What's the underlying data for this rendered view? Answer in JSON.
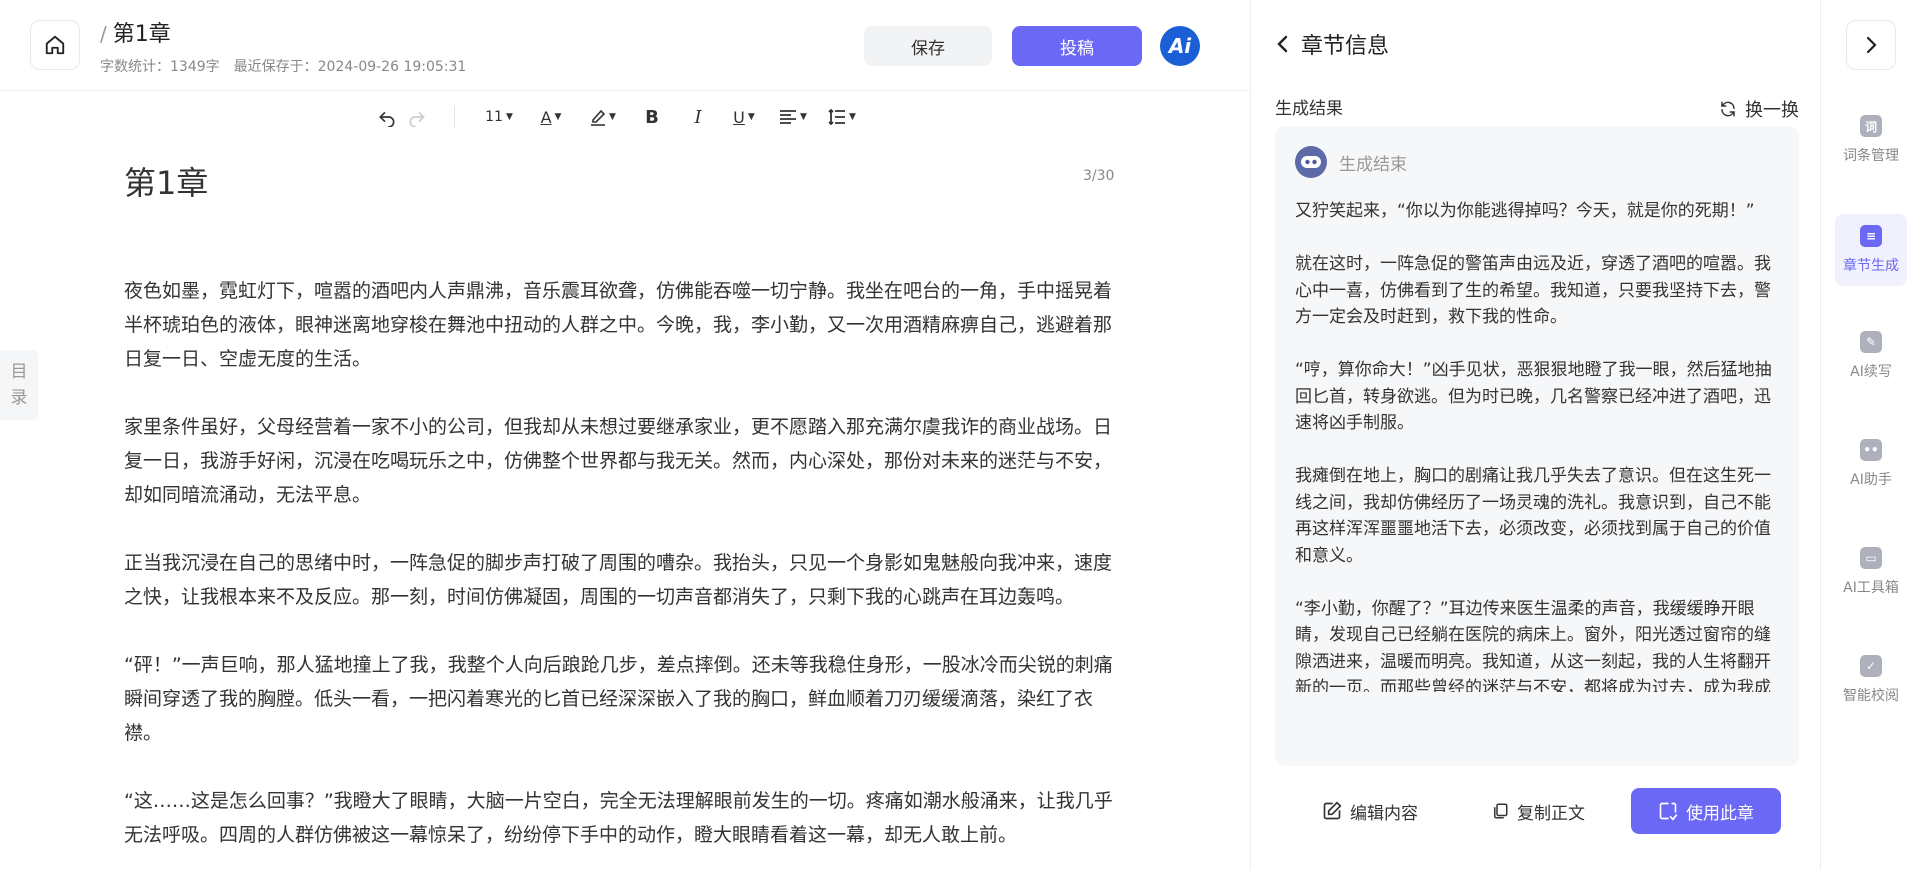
{
  "header": {
    "title": "第1章",
    "word_count": "字数统计：1349字",
    "last_saved": "最近保存于：2024-09-26 19:05:31",
    "save_label": "保存",
    "submit_label": "投稿",
    "ai_badge": "Ai"
  },
  "toolbar": {
    "font_size": "11"
  },
  "editor": {
    "chapter_title": "第1章",
    "counter": "3/30",
    "toc_char1": "目",
    "toc_char2": "录",
    "paragraphs": [
      "夜色如墨，霓虹灯下，喧嚣的酒吧内人声鼎沸，音乐震耳欲聋，仿佛能吞噬一切宁静。我坐在吧台的一角，手中摇晃着半杯琥珀色的液体，眼神迷离地穿梭在舞池中扭动的人群之中。今晚，我，李小勤，又一次用酒精麻痹自己，逃避着那日复一日、空虚无度的生活。",
      "家里条件虽好，父母经营着一家不小的公司，但我却从未想过要继承家业，更不愿踏入那充满尔虞我诈的商业战场。日复一日，我游手好闲，沉浸在吃喝玩乐之中，仿佛整个世界都与我无关。然而，内心深处，那份对未来的迷茫与不安，却如同暗流涌动，无法平息。",
      "正当我沉浸在自己的思绪中时，一阵急促的脚步声打破了周围的嘈杂。我抬头，只见一个身影如鬼魅般向我冲来，速度之快，让我根本来不及反应。那一刻，时间仿佛凝固，周围的一切声音都消失了，只剩下我的心跳声在耳边轰鸣。",
      "“砰！”一声巨响，那人猛地撞上了我，我整个人向后踉跄几步，差点摔倒。还未等我稳住身形，一股冰冷而尖锐的刺痛瞬间穿透了我的胸膛。低头一看，一把闪着寒光的匕首已经深深嵌入了我的胸口，鲜血顺着刀刃缓缓滴落，染红了衣襟。",
      "“这……这是怎么回事？”我瞪大了眼睛，大脑一片空白，完全无法理解眼前发生的一切。疼痛如潮水般涌来，让我几乎无法呼吸。四周的人群仿佛被这一幕惊呆了，纷纷停下手中的动作，瞪大眼睛看着这一幕，却无人敢上前。"
    ]
  },
  "panel": {
    "title": "章节信息",
    "result_label": "生成结果",
    "refresh_label": "换一换",
    "status": "生成结束",
    "generated": [
      "又狞笑起来，“你以为你能逃得掉吗？今天，就是你的死期！”",
      "就在这时，一阵急促的警笛声由远及近，穿透了酒吧的喧嚣。我心中一喜，仿佛看到了生的希望。我知道，只要我坚持下去，警方一定会及时赶到，救下我的性命。",
      "“哼，算你命大！”凶手见状，恶狠狠地瞪了我一眼，然后猛地抽回匕首，转身欲逃。但为时已晚，几名警察已经冲进了酒吧，迅速将凶手制服。",
      "我瘫倒在地上，胸口的剧痛让我几乎失去了意识。但在这生死一线之间，我却仿佛经历了一场灵魂的洗礼。我意识到，自己不能再这样浑浑噩噩地活下去，必须改变，必须找到属于自己的价值和意义。",
      "“李小勤，你醒了？”耳边传来医生温柔的声音，我缓缓睁开眼睛，发现自己已经躺在医院的病床上。窗外，阳光透过窗帘的缝隙洒进来，温暖而明亮。我知道，从这一刻起，我的人生将翻开新的一页。而那些曾经的迷茫与不安，都将成为过去，成为我成长道路上的垫脚石。"
    ],
    "actions": {
      "edit": "编辑内容",
      "copy": "复制正文",
      "use": "使用此章"
    }
  },
  "rail": {
    "items": [
      {
        "label": "词条管理",
        "icon": "glossary-icon"
      },
      {
        "label": "章节生成",
        "icon": "chapter-generate-icon"
      },
      {
        "label": "AI续写",
        "icon": "continue-writing-icon"
      },
      {
        "label": "AI助手",
        "icon": "assistant-robot-icon"
      },
      {
        "label": "AI工具箱",
        "icon": "toolbox-icon"
      },
      {
        "label": "智能校阅",
        "icon": "proofread-icon"
      }
    ]
  },
  "colors": {
    "accent": "#6b68f5",
    "ai_badge": "#1a5fd6"
  }
}
